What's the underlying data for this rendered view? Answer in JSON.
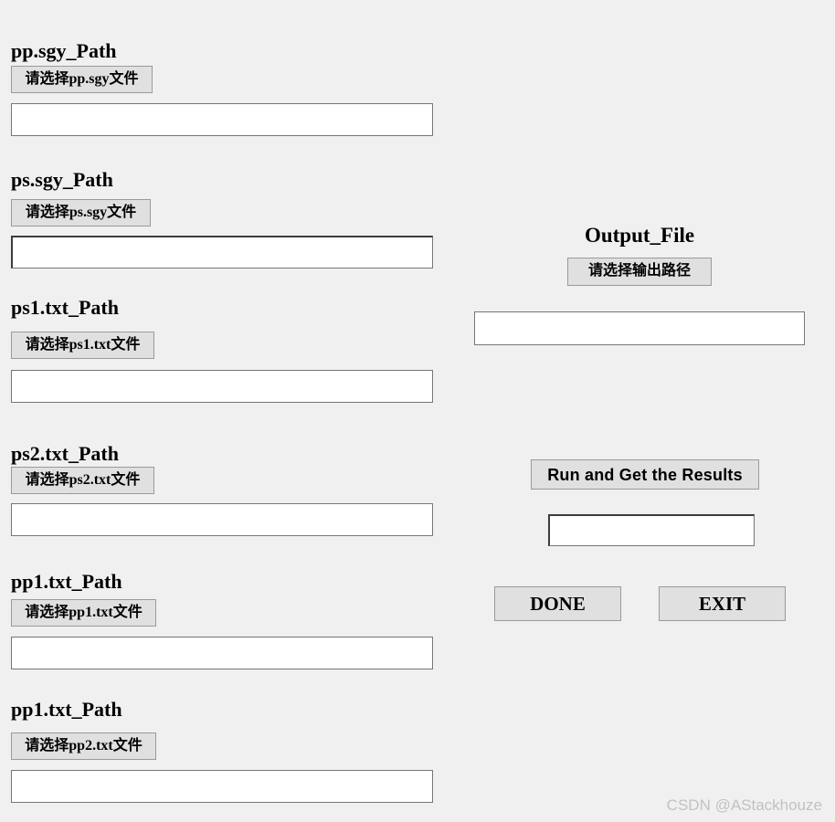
{
  "window": {
    "background_color": "#f0f0f0",
    "button_color": "#e0e0e0",
    "border_color": "#9a9a9a",
    "entry_border_color": "#767676",
    "text_color": "#000000"
  },
  "left_column": {
    "sections": [
      {
        "title": "pp.sgy_Path",
        "button_label": "请选择pp.sgy文件",
        "entry_value": "",
        "entry_placeholder": "",
        "focused": false
      },
      {
        "title": "ps.sgy_Path",
        "button_label": "请选择ps.sgy文件",
        "entry_value": "",
        "entry_placeholder": "",
        "focused": true
      },
      {
        "title": "ps1.txt_Path",
        "button_label": "请选择ps1.txt文件",
        "entry_value": "",
        "entry_placeholder": "",
        "focused": false
      },
      {
        "title": "ps2.txt_Path",
        "button_label": "请选择ps2.txt文件",
        "entry_value": "",
        "entry_placeholder": "",
        "focused": false
      },
      {
        "title": "pp1.txt_Path",
        "button_label": "请选择pp1.txt文件",
        "entry_value": "",
        "entry_placeholder": "",
        "focused": false
      },
      {
        "title": "pp1.txt_Path",
        "button_label": "请选择pp2.txt文件",
        "entry_value": "",
        "entry_placeholder": "",
        "focused": false
      }
    ]
  },
  "right_column": {
    "output": {
      "title": "Output_File",
      "button_label": "请选择输出路径",
      "entry_value": "",
      "entry_placeholder": ""
    },
    "run": {
      "button_label": "Run and Get the Results",
      "result_value": "",
      "result_placeholder": ""
    },
    "actions": {
      "done_label": "DONE",
      "exit_label": "EXIT"
    }
  },
  "watermark": {
    "text": "CSDN @AStackhouze"
  }
}
